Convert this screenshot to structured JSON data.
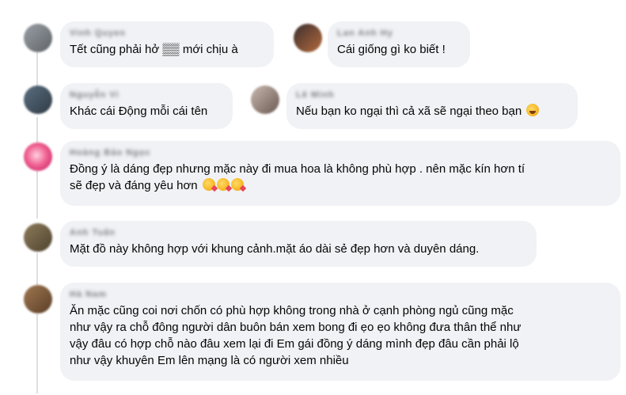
{
  "comments": [
    {
      "author": "Vinh Quyen",
      "text": "Tết cũng phải hở ▒▒ mới chịu à",
      "avatar_colors": [
        "#9aa0a6",
        "#5f6368"
      ]
    },
    {
      "author": "Lan Anh Hy",
      "text": "Cái giống gì ko biết !",
      "avatar_colors": [
        "#3c2f2f",
        "#b46a3c"
      ]
    },
    {
      "author": "Nguyễn Vi",
      "text": "Khác cái Động mỗi cái tên",
      "avatar_colors": [
        "#5b6e80",
        "#2f3b45"
      ]
    },
    {
      "author": "Lê Minh",
      "text": "Nếu bạn ko ngại thì cả xã sẽ ngại theo bạn",
      "emoji": [
        "laugh"
      ],
      "avatar_colors": [
        "#c8b8b0",
        "#6b5a52"
      ]
    },
    {
      "author": "Hoàng Bảo Ngọc",
      "text": "Đồng ý là dáng đẹp nhưng mặc này đi mua hoa là không phù hợp . nên mặc kín hơn tí\nsẽ đẹp và đáng yêu hơn",
      "emoji": [
        "love",
        "love",
        "love"
      ],
      "avatar_colors": [
        "#f06292",
        "#c2185b"
      ]
    },
    {
      "author": "Anh Tuấn",
      "text": "Mặt đồ này không hợp với khung cảnh.mặt áo dài sẻ đẹp hơn và duyên dáng.",
      "avatar_colors": [
        "#8d7b5a",
        "#4e4330"
      ]
    },
    {
      "author": "Hà Nam",
      "text": "Ăn mặc cũng coi nơi chốn có phù hợp không trong nhà ở cạnh phòng ngủ cũng mặc\nnhư vậy ra chỗ đông người dân buôn bán xem bong đi ẹo ẹo không đưa thân thể như\nvậy đâu có hợp chỗ nào đâu xem lại đi Em gái đồng ý dáng mình đẹp đâu cần phải lộ\nnhư vậy khuyên Em lên mạng là có người xem nhiều",
      "avatar_colors": [
        "#a07850",
        "#5a3e28"
      ]
    }
  ]
}
